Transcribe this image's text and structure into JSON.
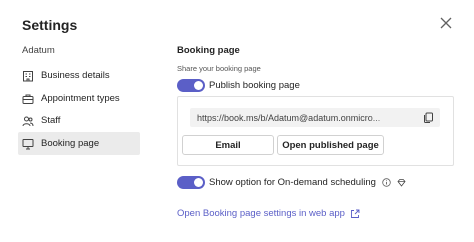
{
  "header": {
    "title": "Settings"
  },
  "sidebar": {
    "org_name": "Adatum",
    "items": [
      {
        "label": "Business details",
        "icon": "building-icon"
      },
      {
        "label": "Appointment types",
        "icon": "briefcase-icon"
      },
      {
        "label": "Staff",
        "icon": "people-icon"
      },
      {
        "label": "Booking page",
        "icon": "monitor-icon",
        "active": true
      }
    ]
  },
  "main": {
    "section_title": "Booking page",
    "share_label": "Share your booking page",
    "publish_toggle": {
      "label": "Publish booking page",
      "on": true
    },
    "url": "https://book.ms/b/Adatum@adatum.onmicro...",
    "email_button": "Email",
    "open_button": "Open published page",
    "ondemand_toggle": {
      "label": "Show option for On-demand scheduling",
      "on": true
    },
    "web_link": "Open Booking page settings in web app"
  },
  "colors": {
    "accent": "#5b5fc7",
    "active_bg": "#ebebeb"
  }
}
